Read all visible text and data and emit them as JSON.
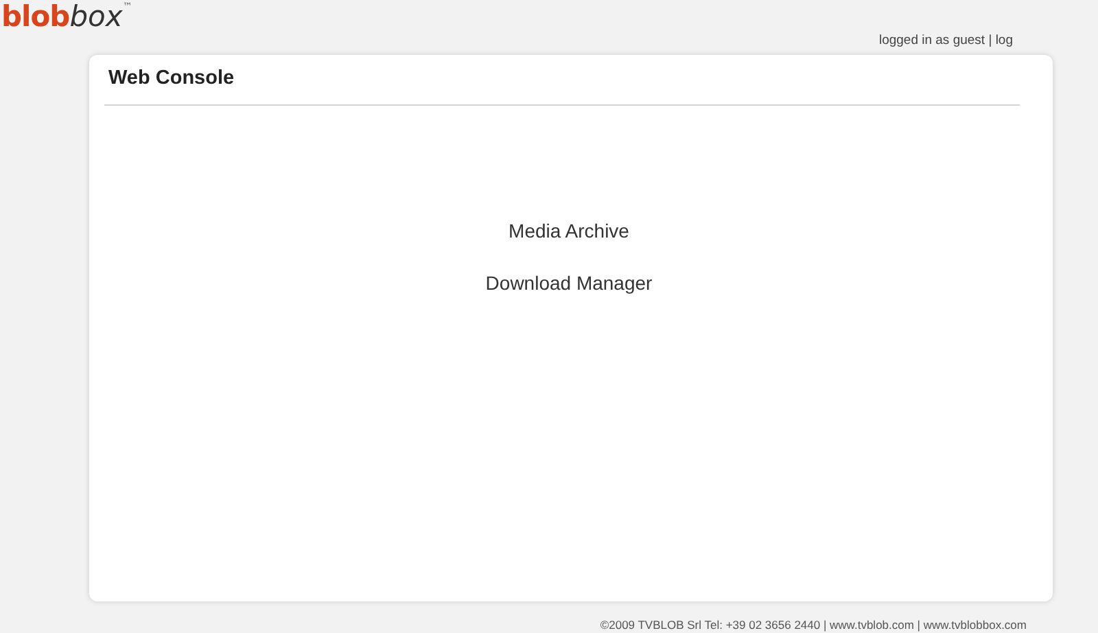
{
  "logo": {
    "brand": "blob",
    "suffix": "box",
    "mark": "™"
  },
  "session": {
    "status": "logged in as guest | log"
  },
  "console": {
    "title": "Web Console",
    "links": [
      {
        "label": "Media Archive"
      },
      {
        "label": "Download Manager"
      }
    ]
  },
  "footer": {
    "text": "©2009 TVBLOB Srl Tel: +39 02 3656 2440 | www.tvblob.com | www.tvblobbox.com"
  }
}
